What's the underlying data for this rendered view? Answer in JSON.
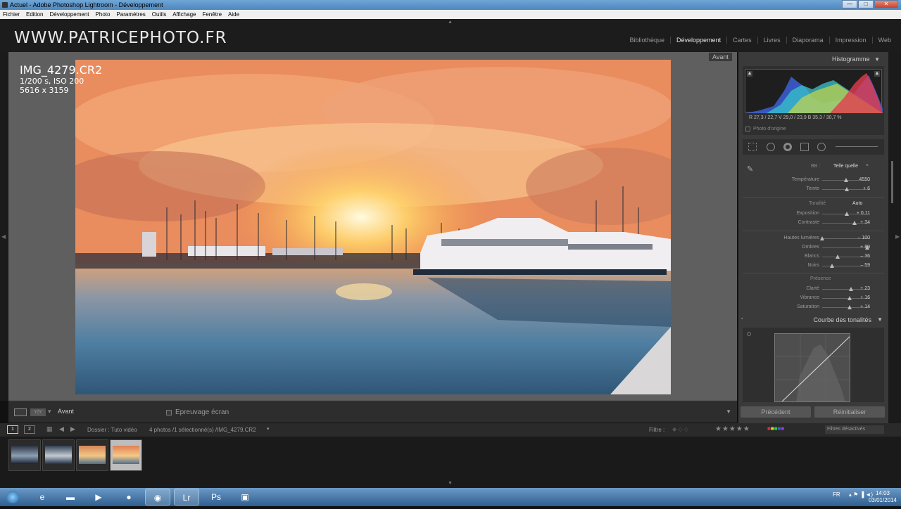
{
  "window": {
    "title": "Actuel - Adobe Photoshop Lightroom - Développement",
    "controls": {
      "minimize": "—",
      "maximize": "□",
      "close": "✕"
    }
  },
  "menu": [
    "Fichier",
    "Edition",
    "Développement",
    "Photo",
    "Paramètres",
    "Outils",
    "Affichage",
    "Fenêtre",
    "Aide"
  ],
  "identity_plate": "WWW.PATRICEPHOTO.FR",
  "modules": [
    "Bibliothèque",
    "Développement",
    "Cartes",
    "Livres",
    "Diaporama",
    "Impression",
    "Web"
  ],
  "active_module": "Développement",
  "photo_info": {
    "filename": "IMG_4279.CR2",
    "exposure": "1/200 s, ISO 200",
    "dimensions": "5616 x 3159"
  },
  "view_badge": "Avant",
  "toolbar": {
    "view_mode": "Y|Y",
    "label": "Avant",
    "soft_proof": "Epreuvage écran"
  },
  "histogram": {
    "title": "Histogramme",
    "rgb_readout": "R  27,3 / 22,7   V  29,0 / 23,9   B  35,3 / 30,7  %",
    "original_photo": "Photo d'origine"
  },
  "basic": {
    "wb_label": "BB :",
    "wb_value": "Telle quelle",
    "tone_label": "Tonalité",
    "auto_label": "Auto",
    "presence_label": "Présence",
    "sliders": [
      {
        "label": "Température",
        "value": "4550",
        "position": 0.5
      },
      {
        "label": "Teinte",
        "value": "+ 6",
        "position": 0.52
      },
      {
        "label": "Exposition",
        "value": "+ 0,11",
        "position": 0.51
      },
      {
        "label": "Contraste",
        "value": "+ 34",
        "position": 0.67
      },
      {
        "label": "Hautes lumières",
        "value": "– 100",
        "position": 0.0
      },
      {
        "label": "Ombres",
        "value": "+ 89",
        "position": 0.94
      },
      {
        "label": "Blancs",
        "value": "– 36",
        "position": 0.32
      },
      {
        "label": "Noirs",
        "value": "– 59",
        "position": 0.2
      },
      {
        "label": "Clarté",
        "value": "+ 23",
        "position": 0.61
      },
      {
        "label": "Vibrance",
        "value": "+ 16",
        "position": 0.58
      },
      {
        "label": "Saturation",
        "value": "+ 14",
        "position": 0.57
      }
    ]
  },
  "tone_curve": {
    "title": "Courbe des tonalités"
  },
  "buttons": {
    "previous": "Précédent",
    "reset": "Réinitialiser"
  },
  "filmstrip_bar": {
    "page1": "1",
    "page2": "2",
    "folder": "Dossier : Tuto vidéo",
    "selection": "4 photos /1 sélectionné(s) /IMG_4279.CR2",
    "filter_label": "Filtre :",
    "stars": "★★★★★",
    "filters_state": "Filtres désactivés"
  },
  "thumbnails": [
    {
      "name": "thumb-1",
      "selected": false,
      "colors": [
        "#2a3342",
        "#8da0b5",
        "#1a2230"
      ]
    },
    {
      "name": "thumb-2",
      "selected": false,
      "colors": [
        "#334055",
        "#c3cad2",
        "#223045"
      ]
    },
    {
      "name": "thumb-3",
      "selected": false,
      "colors": [
        "#d6875a",
        "#f3c685",
        "#4e6d88"
      ]
    },
    {
      "name": "thumb-4",
      "selected": true,
      "colors": [
        "#e07f55",
        "#f6c987",
        "#4d6f8d"
      ]
    }
  ],
  "taskbar": {
    "tray_lang": "FR",
    "time": "14:03",
    "date": "03/01/2014"
  },
  "colors": {
    "panel_bg": "#3a3a3a",
    "canvas_bg": "#5f5f5f",
    "topbar_bg": "#1c1c1c"
  }
}
